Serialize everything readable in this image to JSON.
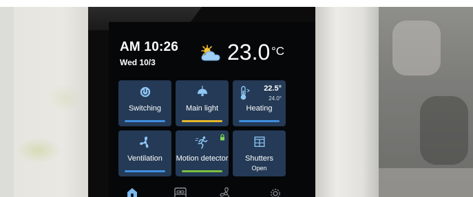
{
  "colors": {
    "tile_background": "#243a56",
    "bar_blue": "#3f8fe0",
    "bar_yellow": "#e8b82c",
    "bar_green": "#7bc13f",
    "icon_blue": "#8fc6f5",
    "lock_green": "#7ed957",
    "nav_active": "#7ab8ee",
    "nav_inactive": "#8d8f94"
  },
  "clock": {
    "time": "AM 10:26",
    "date": "Wed 10/3"
  },
  "weather": {
    "icon": "partly-cloudy-icon",
    "temperature": "23.0",
    "unit": "°C"
  },
  "tiles": [
    {
      "label": "Switching",
      "icon": "power-icon",
      "bar": "blue"
    },
    {
      "label": "Main light",
      "icon": "ceiling-lamp-icon",
      "bar": "yellow"
    },
    {
      "label": "Heating",
      "icon": "thermometer-icon",
      "bar": "blue",
      "set_temp": "22.5°",
      "current_temp": "24.0°"
    },
    {
      "label": "Ventilation",
      "icon": "fan-icon",
      "bar": "blue"
    },
    {
      "label": "Motion detector",
      "icon": "running-person-icon",
      "bar": "green",
      "locked": true
    },
    {
      "label": "Shutters",
      "icon": "window-shutter-icon",
      "status": "Open"
    }
  ],
  "nav": [
    {
      "name": "home",
      "icon": "home-icon",
      "active": true
    },
    {
      "name": "rooms",
      "icon": "bed-icon",
      "active": false
    },
    {
      "name": "functions",
      "icon": "fan-icon",
      "active": false
    },
    {
      "name": "settings",
      "icon": "gear-icon",
      "active": false
    }
  ]
}
